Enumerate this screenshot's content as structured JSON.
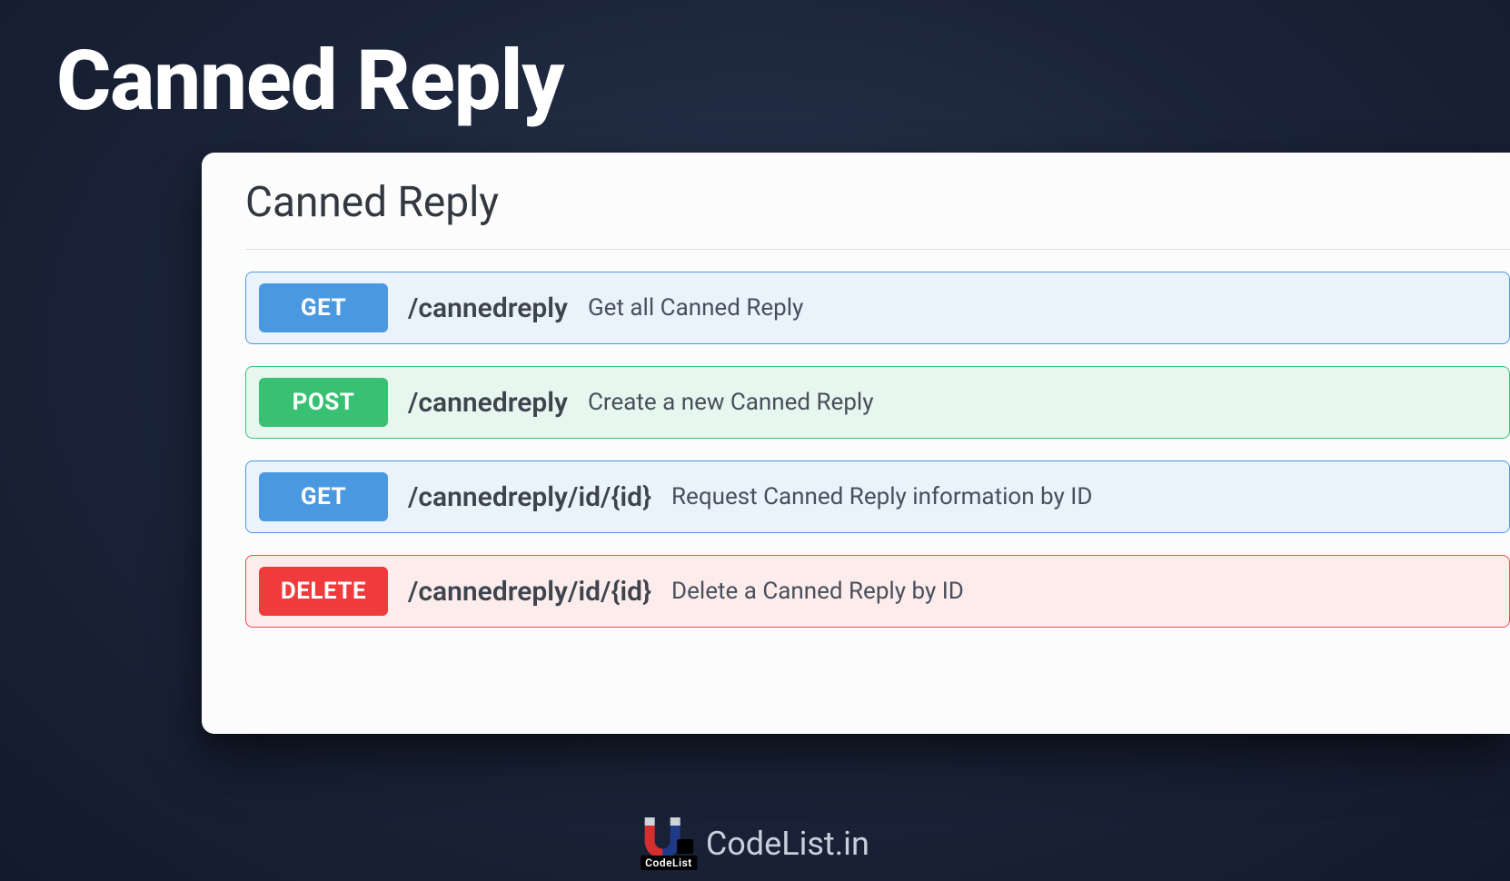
{
  "page": {
    "title": "Canned Reply"
  },
  "panel": {
    "heading": "Canned Reply",
    "endpoints": [
      {
        "method": "GET",
        "method_class": "get",
        "path": "/cannedreply",
        "description": "Get all Canned Reply"
      },
      {
        "method": "POST",
        "method_class": "post",
        "path": "/cannedreply",
        "description": "Create a new Canned Reply"
      },
      {
        "method": "GET",
        "method_class": "get",
        "path": "/cannedreply/id/{id}",
        "description": "Request Canned Reply information by ID"
      },
      {
        "method": "DELETE",
        "method_class": "delete",
        "path": "/cannedreply/id/{id}",
        "description": "Delete a Canned Reply by ID"
      }
    ]
  },
  "footer": {
    "brand_text": "CodeList.in",
    "brand_sub": "CodeList"
  }
}
